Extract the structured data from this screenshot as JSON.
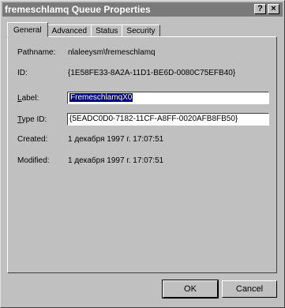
{
  "window": {
    "title": "fremeschlamq Queue Properties",
    "help_glyph": "?",
    "close_glyph": "×"
  },
  "tabs": [
    {
      "label": "General",
      "active": true
    },
    {
      "label": "Advanced",
      "active": false
    },
    {
      "label": "Status",
      "active": false
    },
    {
      "label": "Security",
      "active": false
    }
  ],
  "general": {
    "pathname_label": "Pathname:",
    "pathname_value": "nlaleeysm\\fremeschlamq",
    "id_label": "ID:",
    "id_value": "{1E58FE33-8A2A-11D1-BE6D-0080C75EFB40}",
    "label_label": "Label:",
    "label_value": "FremeschlamqX0",
    "typeid_label": "Type ID:",
    "typeid_value": "{5EADC0D0-7182-11CF-A8FF-0020AFB8FB50}",
    "created_label": "Created:",
    "created_value": "1 декабря 1997 г. 17:07:51",
    "modified_label": "Modified:",
    "modified_value": "1 декабря 1997 г. 17:07:51"
  },
  "buttons": {
    "ok": "OK",
    "cancel": "Cancel"
  },
  "colors": {
    "titlebar": "#7a7a7a",
    "face": "#c0c0c0",
    "selection": "#000080"
  }
}
